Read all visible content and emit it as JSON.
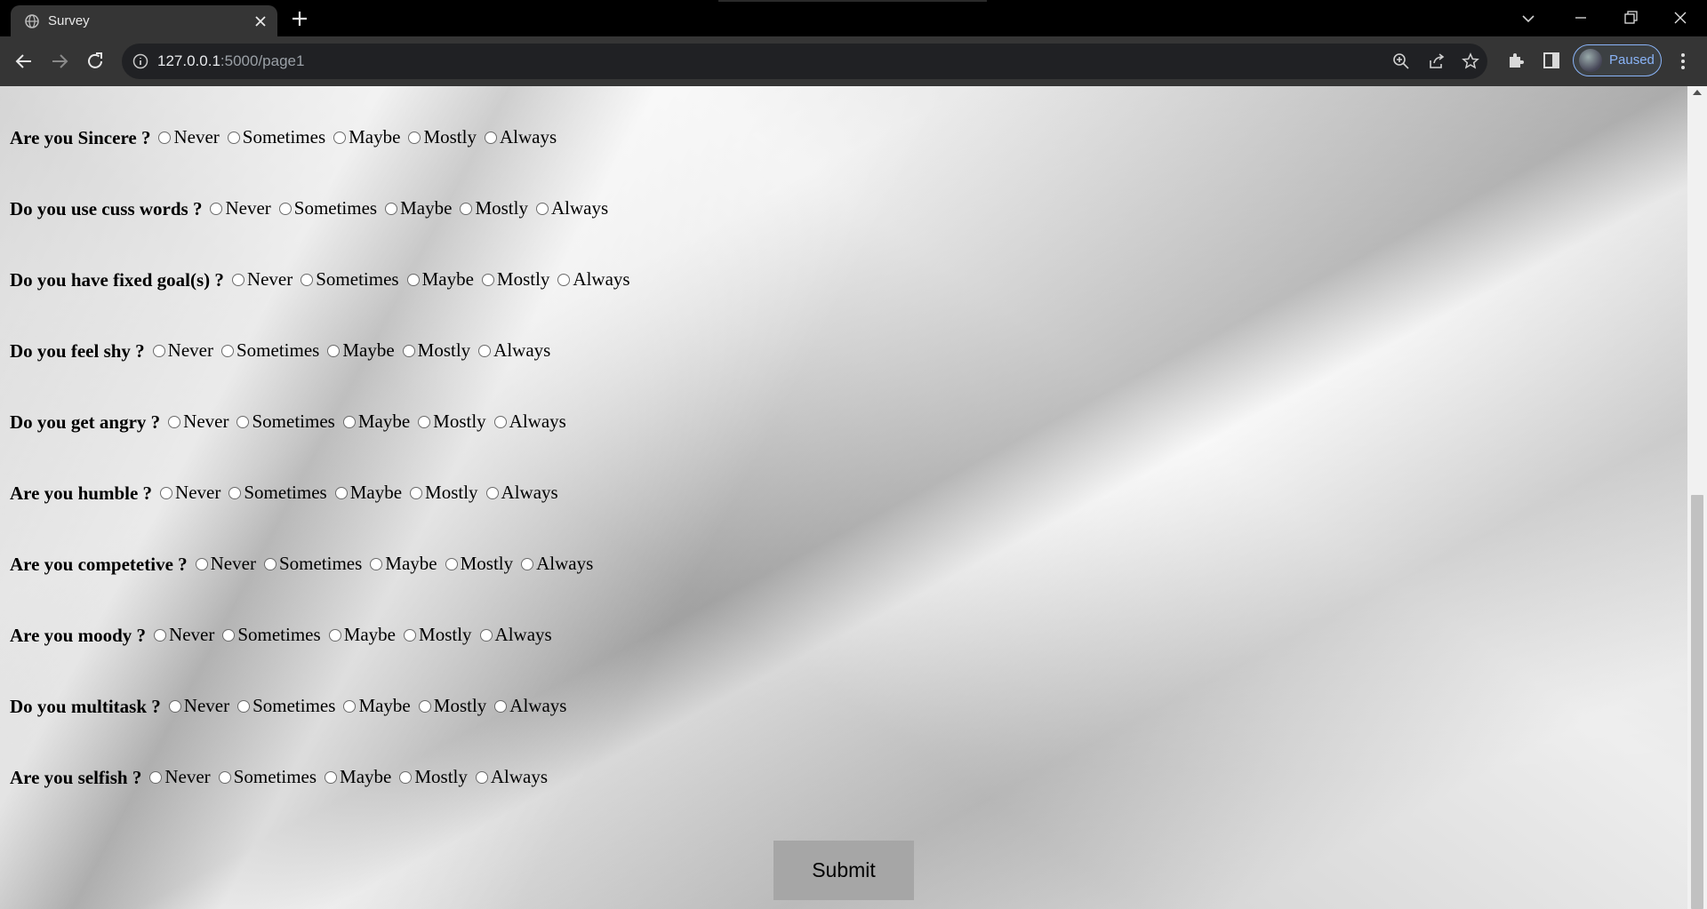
{
  "browser": {
    "tab_title": "Survey",
    "url_host": "127.0.0.1",
    "url_path": ":5000/page1",
    "profile_status": "Paused"
  },
  "survey": {
    "options": [
      "Never",
      "Sometimes",
      "Maybe",
      "Mostly",
      "Always"
    ],
    "questions": [
      "Are you Sincere ?",
      "Do you use cuss words ?",
      "Do you have fixed goal(s) ?",
      "Do you feel shy ?",
      "Do you get angry ?",
      "Are you humble ?",
      "Are you competetive ?",
      "Are you moody ?",
      "Do you multitask ?",
      "Are you selfish ?"
    ],
    "submit_label": "Submit"
  },
  "colors": {
    "chrome_bg": "#000000",
    "toolbar_bg": "#353535",
    "profile_accent": "#8ab4f8",
    "submit_bg": "#a6a6a6"
  }
}
